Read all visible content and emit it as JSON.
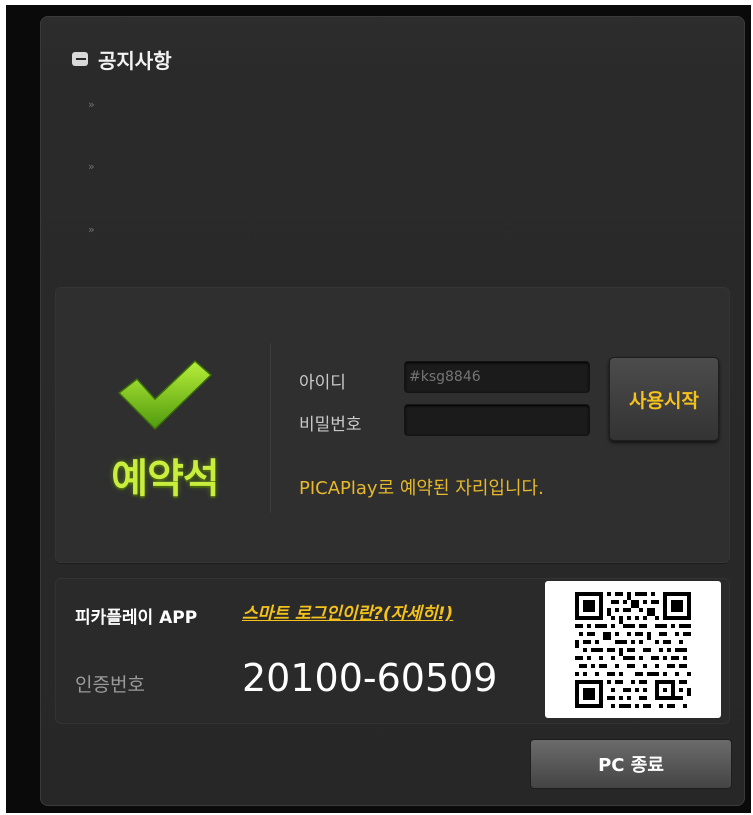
{
  "notice": {
    "title": "공지사항",
    "icon": "speech-bubble-icon",
    "bullets": [
      "»",
      "»",
      "»"
    ]
  },
  "reservation": {
    "status_label": "예약석",
    "status_icon": "check-icon",
    "id_label": "아이디",
    "id_placeholder": "#ksg8846",
    "password_label": "비밀번호",
    "password_value": "",
    "start_button": "사용시작",
    "message": "PICAPlay로 예약된 자리입니다."
  },
  "app": {
    "name": "피카플레이 APP",
    "link": "스마트 로그인이란?(자세히!)",
    "auth_label": "인증번호",
    "auth_code": "20100-60509",
    "qr_icon": "qr-code-icon"
  },
  "footer": {
    "pc_exit_button": "PC 종료"
  },
  "colors": {
    "accent_yellow": "#f5c21c",
    "check_green": "#7ec41c",
    "status_text": "#c9ee3c",
    "panel_bg": "#2a2a2a"
  }
}
